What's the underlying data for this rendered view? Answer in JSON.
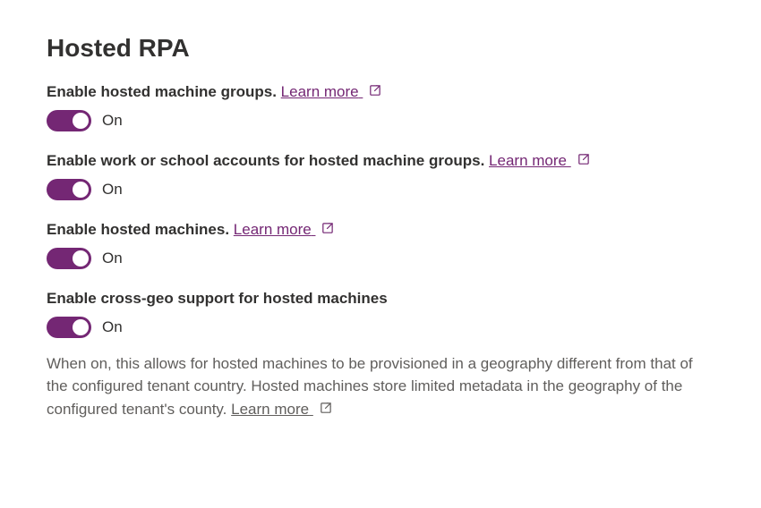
{
  "section": {
    "title": "Hosted RPA"
  },
  "settings": {
    "hosted_machine_groups": {
      "label": "Enable hosted machine groups.",
      "learn_more": "Learn more",
      "state": "On"
    },
    "work_school_accounts": {
      "label": "Enable work or school accounts for hosted machine groups.",
      "learn_more": "Learn more",
      "state": "On"
    },
    "hosted_machines": {
      "label": "Enable hosted machines.",
      "learn_more": "Learn more",
      "state": "On"
    },
    "cross_geo": {
      "label": "Enable cross-geo support for hosted machines",
      "state": "On",
      "description": "When on, this allows for hosted machines to be provisioned in a geography different from that of the configured tenant country. Hosted machines store limited metadata in the geography of the configured tenant's county.",
      "learn_more": "Learn more"
    }
  }
}
